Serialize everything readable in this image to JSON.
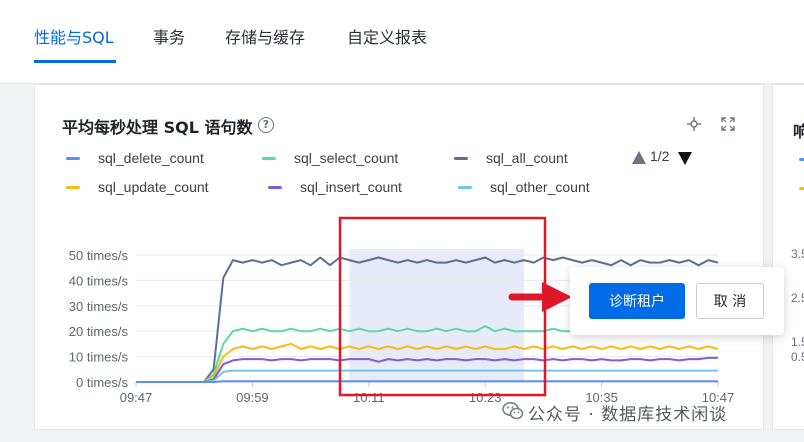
{
  "tabs": [
    {
      "label": "性能与SQL",
      "active": true
    },
    {
      "label": "事务",
      "active": false
    },
    {
      "label": "存储与缓存",
      "active": false
    },
    {
      "label": "自定义报表",
      "active": false
    }
  ],
  "panel": {
    "title": "平均每秒处理 SQL 语句数",
    "help_icon": "question-circle-icon",
    "tool_icons": [
      "crosshair-icon",
      "expand-icon"
    ]
  },
  "legend": {
    "items": [
      {
        "label": "sql_delete_count",
        "color": "#5b8ff9"
      },
      {
        "label": "sql_select_count",
        "color": "#5ad8a6"
      },
      {
        "label": "sql_all_count",
        "color": "#5d7092"
      },
      {
        "label": "sql_update_count",
        "color": "#f6bd16"
      },
      {
        "label": "sql_insert_count",
        "color": "#7c5ce0"
      },
      {
        "label": "sql_other_count",
        "color": "#6dc8ec"
      }
    ],
    "pager": "1/2"
  },
  "chart_data": {
    "type": "line",
    "x": [
      "09:47",
      "09:48",
      "09:49",
      "09:50",
      "09:51",
      "09:52",
      "09:53",
      "09:54",
      "09:55",
      "09:56",
      "09:57",
      "09:58",
      "09:59",
      "10:00",
      "10:01",
      "10:02",
      "10:03",
      "10:04",
      "10:05",
      "10:06",
      "10:07",
      "10:08",
      "10:09",
      "10:10",
      "10:11",
      "10:12",
      "10:13",
      "10:14",
      "10:15",
      "10:16",
      "10:17",
      "10:18",
      "10:19",
      "10:20",
      "10:21",
      "10:22",
      "10:23",
      "10:24",
      "10:25",
      "10:26",
      "10:27",
      "10:28",
      "10:29",
      "10:30",
      "10:31",
      "10:32",
      "10:33",
      "10:34",
      "10:35",
      "10:36",
      "10:37",
      "10:38",
      "10:39",
      "10:40",
      "10:41",
      "10:42",
      "10:43",
      "10:44",
      "10:45",
      "10:46",
      "10:47"
    ],
    "x_ticks": [
      "09:47",
      "09:59",
      "10:11",
      "10:23",
      "10:35",
      "10:47"
    ],
    "y_ticks": [
      "0 times/s",
      "10 times/s",
      "20 times/s",
      "30 times/s",
      "40 times/s",
      "50 times/s"
    ],
    "ylim": [
      0,
      50
    ],
    "grid": true,
    "series": [
      {
        "name": "sql_all_count",
        "color": "#5d7092",
        "values": [
          0,
          0,
          0,
          0,
          0,
          0,
          0,
          0,
          5,
          41,
          48,
          47,
          48,
          47,
          48,
          46,
          47,
          48,
          46,
          49,
          46,
          49,
          48,
          47,
          48,
          49,
          48,
          47,
          48,
          47,
          48,
          47,
          47,
          48,
          47,
          48,
          49,
          47,
          48,
          47,
          48,
          47,
          49,
          48,
          49,
          48,
          47,
          48,
          47,
          46,
          48,
          46,
          48,
          47,
          47,
          48,
          47,
          48,
          46,
          48,
          47
        ]
      },
      {
        "name": "sql_select_count",
        "color": "#5ad8a6",
        "values": [
          0,
          0,
          0,
          0,
          0,
          0,
          0,
          0,
          3,
          15,
          20,
          21,
          20,
          21,
          20,
          20,
          21,
          20,
          20,
          21,
          20,
          21,
          20,
          21,
          20,
          20,
          21,
          20,
          21,
          20,
          20,
          21,
          20,
          21,
          20,
          20,
          22,
          20,
          21,
          20,
          20,
          20,
          20,
          21,
          20,
          20,
          21,
          20,
          20,
          21,
          20,
          20,
          21,
          20,
          21,
          20,
          20,
          21,
          20,
          21,
          20
        ]
      },
      {
        "name": "sql_update_count",
        "color": "#f6bd16",
        "values": [
          0,
          0,
          0,
          0,
          0,
          0,
          0,
          0,
          2,
          10,
          13,
          14,
          13,
          14,
          13,
          14,
          15,
          13,
          14,
          13,
          14,
          13,
          14,
          13,
          14,
          13,
          14,
          13,
          14,
          13,
          14,
          13,
          14,
          13,
          14,
          13,
          14,
          13,
          13,
          14,
          13,
          14,
          13,
          14,
          13,
          14,
          13,
          14,
          13,
          14,
          13,
          14,
          13,
          14,
          13,
          14,
          13,
          14,
          13,
          14,
          13
        ]
      },
      {
        "name": "sql_insert_count",
        "color": "#7c5ce0",
        "values": [
          0,
          0,
          0,
          0,
          0,
          0,
          0,
          0,
          1,
          7,
          8.5,
          9,
          9,
          9,
          8.5,
          9,
          9,
          8.5,
          9,
          9,
          9,
          8.5,
          9,
          9,
          9,
          8,
          9,
          8.5,
          9,
          8.5,
          9,
          8.5,
          9,
          9,
          8.5,
          9,
          9,
          8.5,
          9,
          8.5,
          9,
          9,
          8.5,
          9,
          8.5,
          9,
          9,
          8.5,
          9,
          8.5,
          8.5,
          9,
          9,
          8.5,
          9,
          9,
          8.5,
          9,
          9,
          9.5,
          9.5
        ]
      },
      {
        "name": "sql_other_count",
        "color": "#6dc8ec",
        "values": [
          0,
          0,
          0,
          0,
          0,
          0,
          0,
          0,
          0.5,
          4,
          4.5,
          4.5,
          4.5,
          4.5,
          4.5,
          4.5,
          4.5,
          4.5,
          4.5,
          4.5,
          4.5,
          4.5,
          4.5,
          4.5,
          4.5,
          4.5,
          4.5,
          4.5,
          4.5,
          4.5,
          4.5,
          4.5,
          4.5,
          4.5,
          4.5,
          4.5,
          4.5,
          4.5,
          4.5,
          4.5,
          4.5,
          4.5,
          4.5,
          4.5,
          4.5,
          4.5,
          4.5,
          4.5,
          4.5,
          4.5,
          4.5,
          4.5,
          4.5,
          4.5,
          4.5,
          4.5,
          4.5,
          4.5,
          4.5,
          4.5,
          4.5
        ]
      },
      {
        "name": "sql_delete_count",
        "color": "#5b8ff9",
        "values": [
          0,
          0,
          0,
          0,
          0,
          0,
          0,
          0,
          0,
          0.3,
          0.3,
          0.3,
          0.3,
          0.3,
          0.3,
          0.3,
          0.3,
          0.3,
          0.3,
          0.3,
          0.3,
          0.3,
          0.3,
          0.3,
          0.3,
          0.3,
          0.3,
          0.3,
          0.3,
          0.3,
          0.3,
          0.3,
          0.3,
          0.3,
          0.3,
          0.3,
          0.3,
          0.3,
          0.3,
          0.3,
          0.3,
          0.3,
          0.3,
          0.3,
          0.3,
          0.3,
          0.3,
          0.3,
          0.3,
          0.3,
          0.3,
          0.3,
          0.3,
          0.3,
          0.3,
          0.3,
          0.3,
          0.3,
          0.3,
          0.3,
          0.3
        ]
      }
    ],
    "selection": {
      "x_start": "10:09",
      "x_end": "10:27",
      "color": "#e6ebf7"
    },
    "highlight_box_color": "#e0162b"
  },
  "popover": {
    "primary_label": "诊断租户",
    "secondary_label": "取 消"
  },
  "annotation_arrow_color": "#e0162b",
  "side_panel": {
    "title": "响",
    "y_ticks": [
      "3.5",
      "2.5",
      "1.5",
      "0.5"
    ],
    "marks": [
      "#5b8ff9",
      "#f6bd16"
    ]
  },
  "watermark": {
    "icon": "wechat-icon",
    "text": "公众号 · 数据库技术闲谈"
  }
}
